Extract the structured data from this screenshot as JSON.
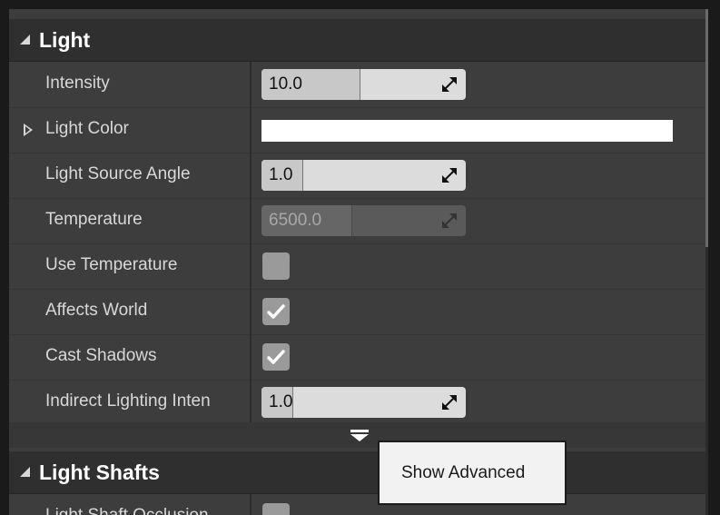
{
  "sections": {
    "light": {
      "title": "Light"
    },
    "light_shafts": {
      "title": "Light Shafts"
    }
  },
  "properties": {
    "intensity": {
      "label": "Intensity",
      "value": "10.0",
      "fill": 0.48
    },
    "light_color": {
      "label": "Light Color",
      "color": "#ffffff"
    },
    "light_source_angle": {
      "label": "Light Source Angle",
      "value": "1.0",
      "fill": 0.2
    },
    "temperature": {
      "label": "Temperature",
      "value": "6500.0",
      "fill": 0.44,
      "enabled": false
    },
    "use_temperature": {
      "label": "Use Temperature",
      "checked": false
    },
    "affects_world": {
      "label": "Affects World",
      "checked": true
    },
    "cast_shadows": {
      "label": "Cast Shadows",
      "checked": true
    },
    "indirect_lighting_intensity": {
      "label": "Indirect Lighting Inten",
      "value": "1.0",
      "fill": 0.15
    },
    "light_shaft_occlusion": {
      "label": "Light Shaft Occlusion",
      "checked": false
    }
  },
  "advanced": {
    "tooltip": "Show Advanced"
  },
  "colors": {
    "panel_bg": "#3d3d3d",
    "header_bg": "#2f2f2f",
    "field_bg": "#dcdcdc",
    "checkbox_bg": "#9a9a9a"
  }
}
